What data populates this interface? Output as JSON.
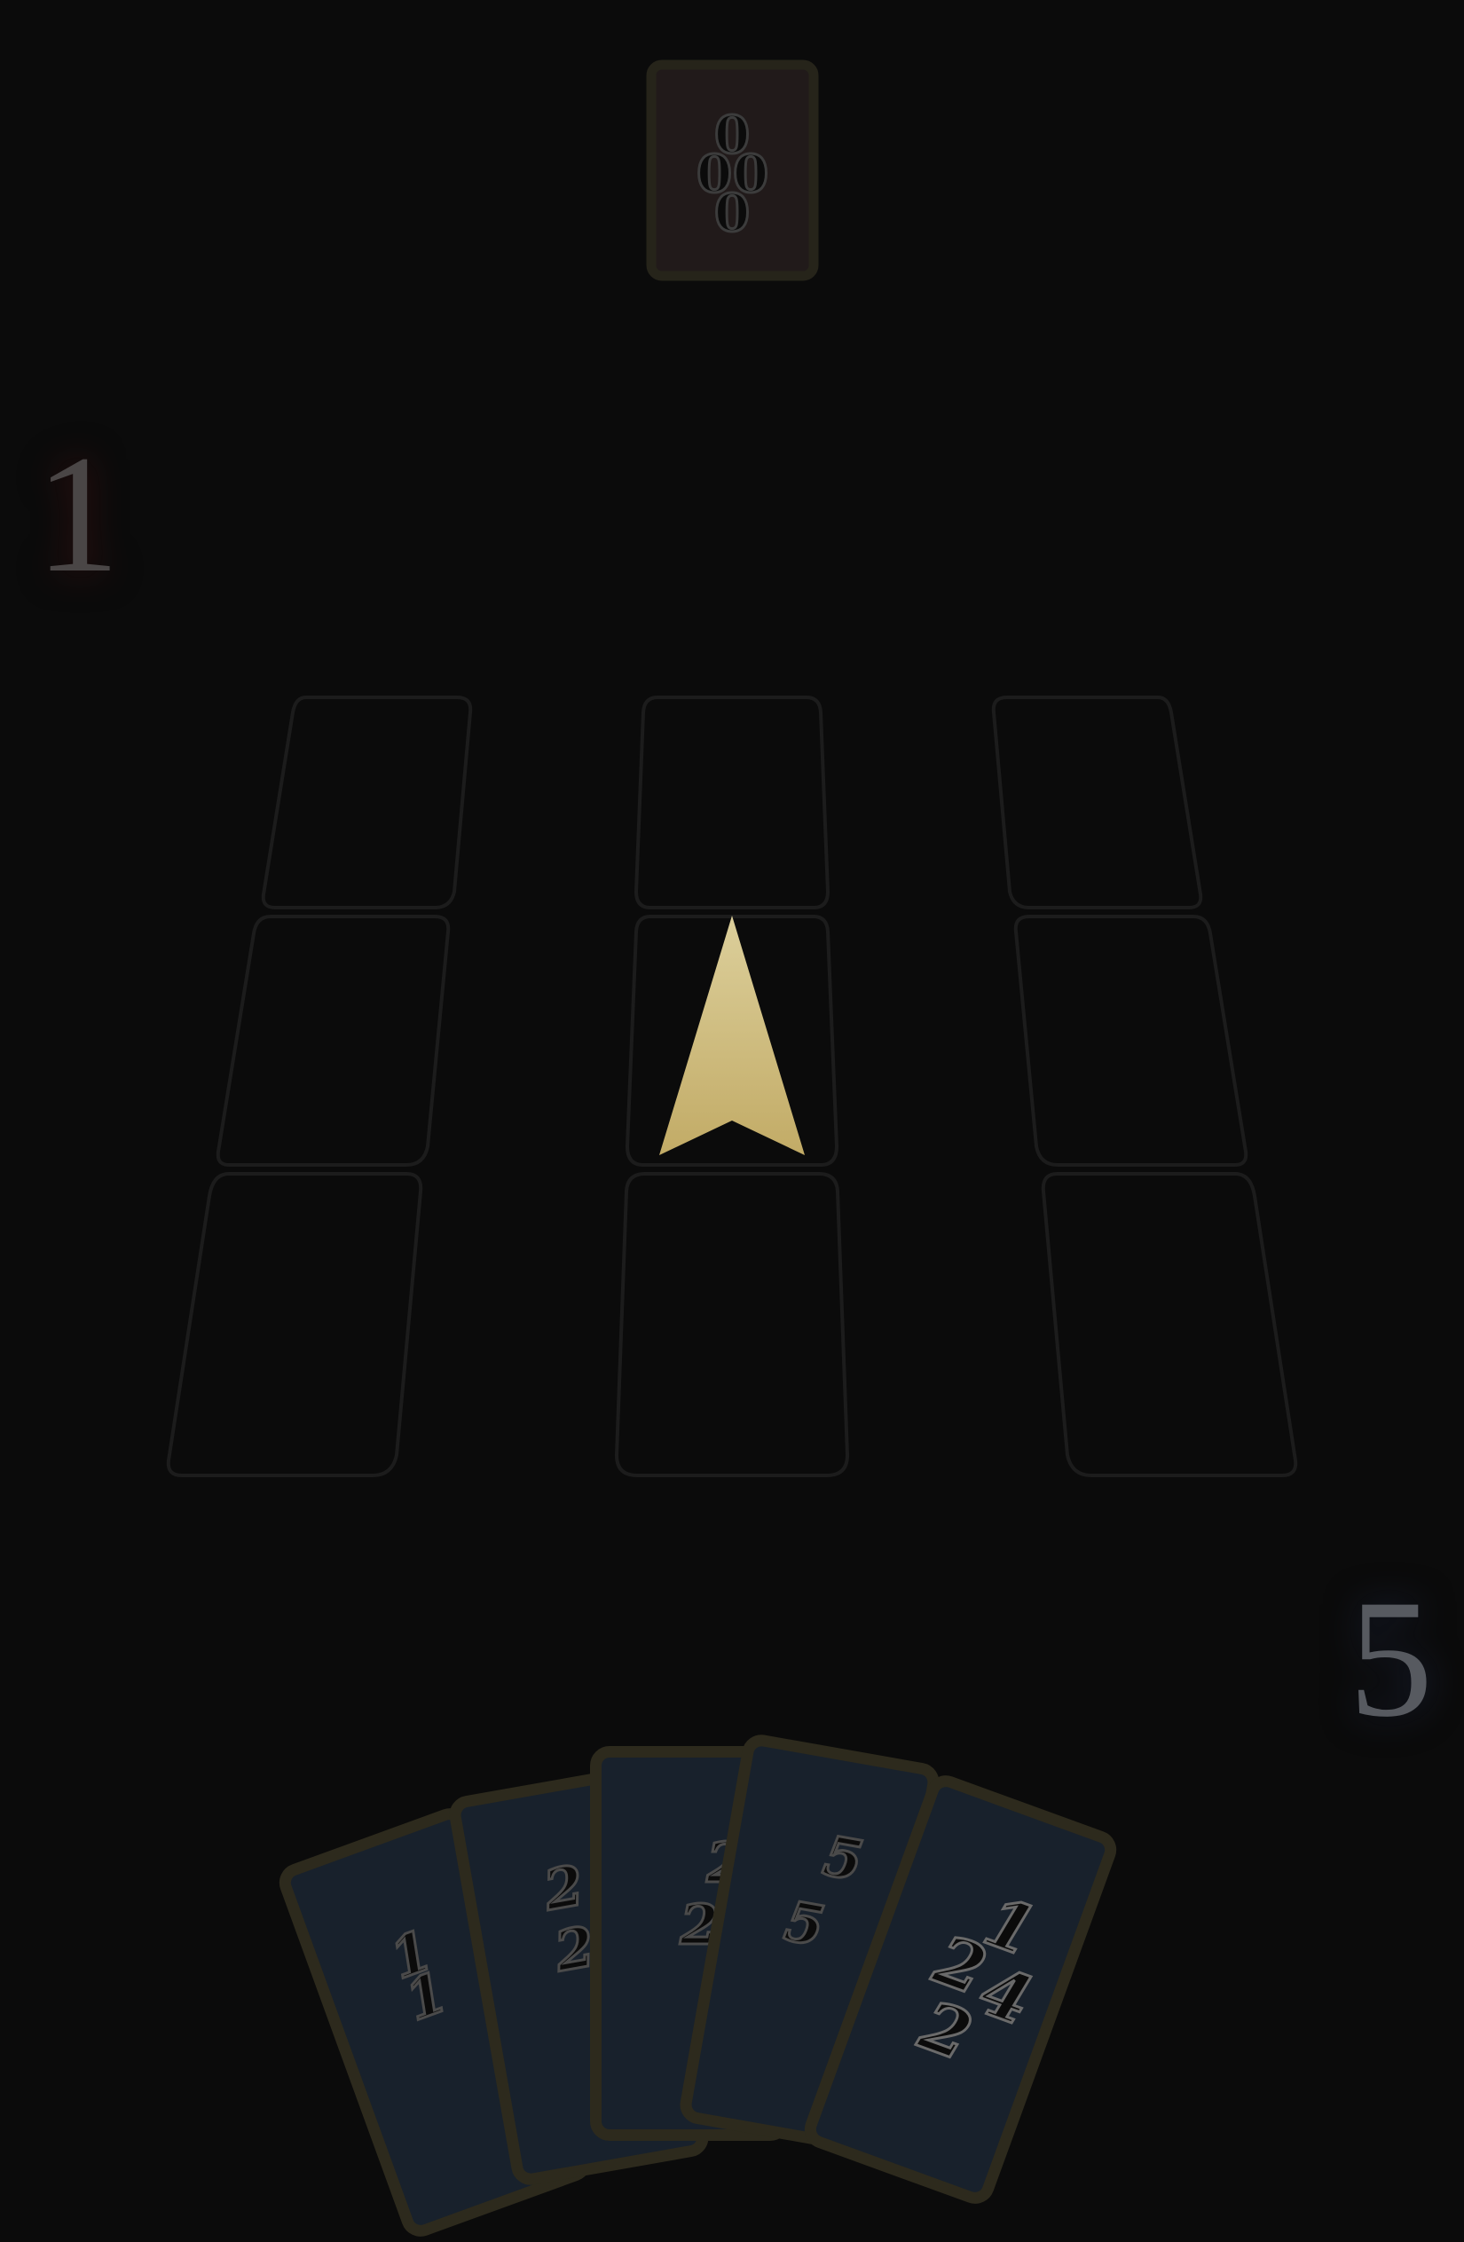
{
  "opponent_card": {
    "pips": [
      "0",
      "0",
      "0",
      "0"
    ]
  },
  "scores": {
    "left": "1",
    "right": "5"
  },
  "board": {
    "cells": 9,
    "cursor_cell": "middle-center"
  },
  "hand": {
    "cards": [
      {
        "pips": [
          "1",
          "1"
        ]
      },
      {
        "pips": [
          "2",
          "2"
        ]
      },
      {
        "pips": [
          "2",
          "2"
        ]
      },
      {
        "pips": [
          "5",
          "5"
        ]
      },
      {
        "pips": [
          "1",
          "2",
          "4",
          "2"
        ]
      }
    ]
  },
  "colors": {
    "background": "#0b0b0b",
    "card_back": "#18212c",
    "card_border": "#2d2a1d",
    "opponent_card_fill": "#211a1a",
    "cursor_arrow": "#cbb576",
    "grid_outline": "#1e1e1e"
  }
}
